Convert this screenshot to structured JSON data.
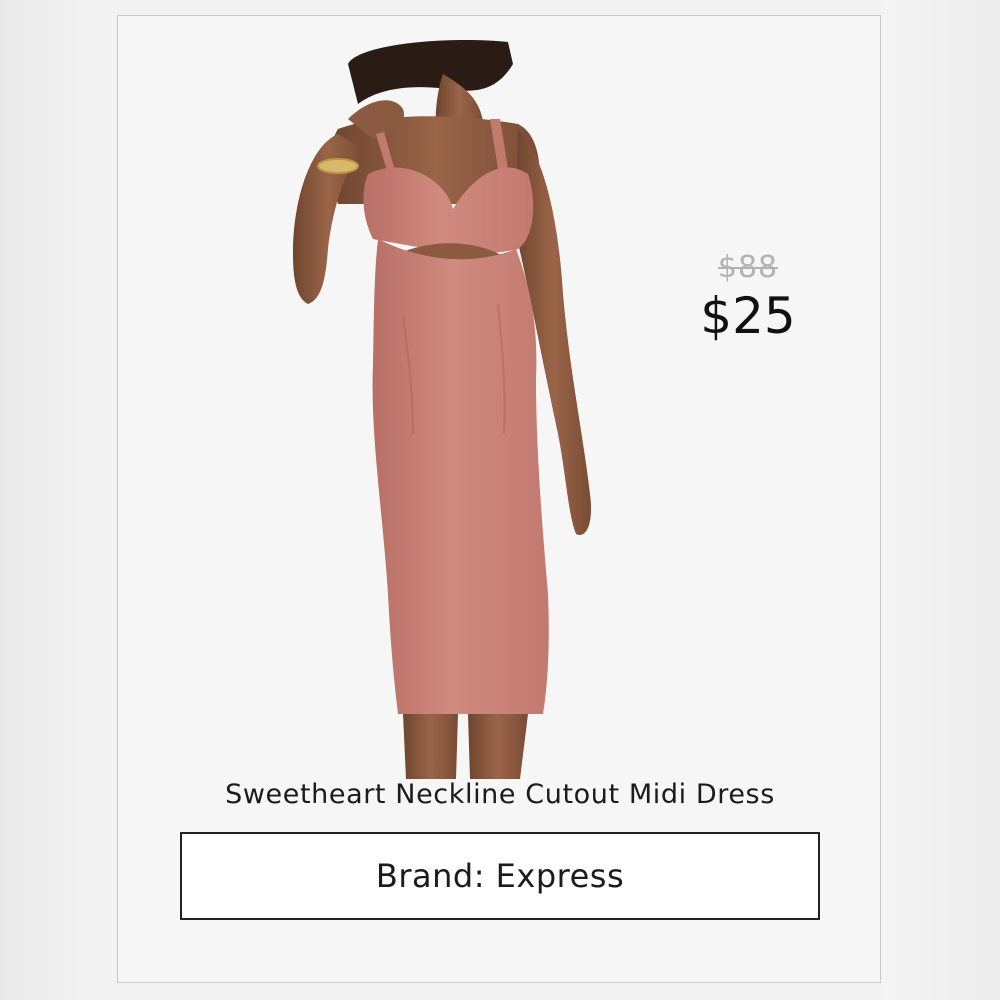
{
  "product": {
    "image_alt": "Woman wearing a dusty-pink sweetheart neckline cutout midi dress",
    "original_price": "$88",
    "sale_price": "$25",
    "name": "Sweetheart Neckline Cutout Midi Dress",
    "brand_label": "Brand: Express"
  },
  "colors": {
    "dress": "#c98277",
    "skin": "#8a5a41",
    "hair": "#2a1c15",
    "background": "#f6f6f6"
  }
}
